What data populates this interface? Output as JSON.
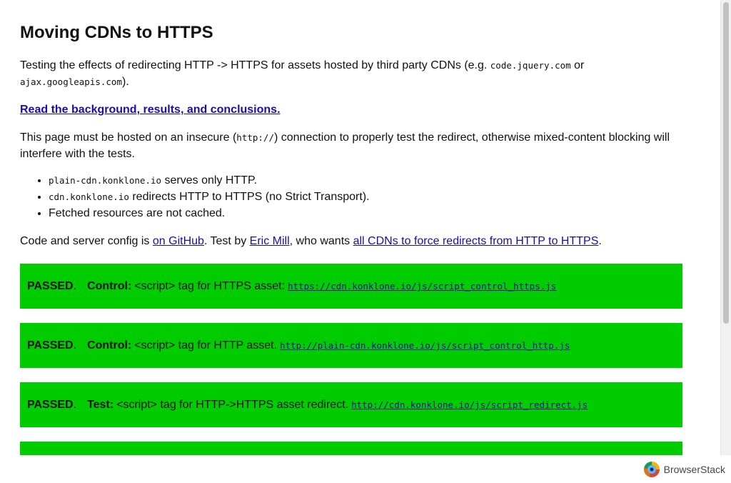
{
  "page": {
    "title": "Moving CDNs to HTTPS",
    "intro": {
      "prefix": "Testing the effects of redirecting HTTP -> HTTPS for assets hosted by third party CDNs (e.g. ",
      "code1": "code.jquery.com",
      "middle": " or ",
      "code2": "ajax.googleapis.com",
      "suffix": ")."
    },
    "read_link": "Read the background, results, and conclusions.",
    "hosted": {
      "prefix": "This page must be hosted on an insecure (",
      "code": "http://",
      "suffix": ") connection to properly test the redirect, otherwise mixed-content blocking will interfere with the tests."
    },
    "bullets": [
      {
        "code": "plain-cdn.konklone.io",
        "text": " serves only HTTP."
      },
      {
        "code": "cdn.konklone.io",
        "text": " redirects HTTP to HTTPS (no Strict Transport)."
      },
      {
        "code": "",
        "text": "Fetched resources are not cached."
      }
    ],
    "code_line": {
      "prefix": "Code and server config is ",
      "github_link": "on GitHub",
      "mid1": ". Test by ",
      "author_link": "Eric Mill",
      "mid2": ", who wants ",
      "wants_link": "all CDNs to force redirects from HTTP to HTTPS",
      "suffix": "."
    },
    "tests": [
      {
        "status": "PASSED",
        "kind": "Control:",
        "desc": "<script> tag for HTTPS asset:",
        "url": "https://cdn.konklone.io/js/script_control_https.js"
      },
      {
        "status": "PASSED",
        "kind": "Control:",
        "desc": "<script> tag for HTTP asset.",
        "url": "http://plain-cdn.konklone.io/js/script_control_http.js"
      },
      {
        "status": "PASSED",
        "kind": "Test:",
        "desc": "<script> tag for HTTP->HTTPS asset redirect.",
        "url": "http://cdn.konklone.io/js/script_redirect.js"
      },
      {
        "status": "",
        "kind": "",
        "desc": "",
        "url": ""
      }
    ],
    "status_color": "#00cc00"
  },
  "footer": {
    "brand_name": "BrowserStack",
    "brand_icon": "browserstack-logo-icon"
  }
}
